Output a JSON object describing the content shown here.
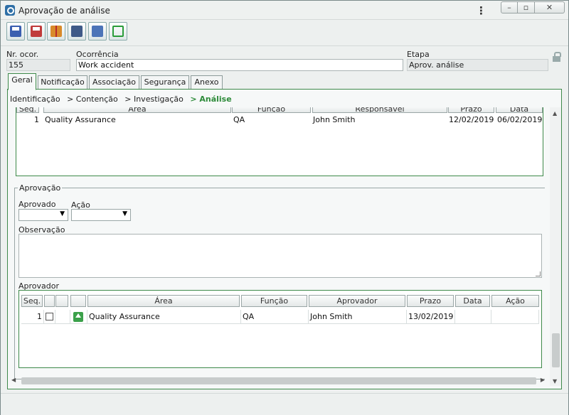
{
  "window": {
    "title": "Aprovação de análise"
  },
  "toolbar": {
    "buttons": [
      {
        "icon": "save-icon"
      },
      {
        "icon": "save-and-exit-icon"
      },
      {
        "icon": "gift-icon"
      },
      {
        "icon": "binoculars-icon"
      },
      {
        "icon": "user-icon"
      },
      {
        "icon": "refresh-icon"
      }
    ]
  },
  "header": {
    "nr_label": "Nr. ocor.",
    "nr_value": "155",
    "ocorrencia_label": "Ocorrência",
    "ocorrencia_value": "Work accident",
    "etapa_label": "Etapa",
    "etapa_value": "Aprov. análise"
  },
  "tabs": [
    {
      "label": "Geral"
    },
    {
      "label": "Notificação"
    },
    {
      "label": "Associação"
    },
    {
      "label": "Segurança"
    },
    {
      "label": "Anexo"
    }
  ],
  "breadcrumb": {
    "items": [
      "Identificação",
      "> Contenção",
      "> Investigação"
    ],
    "current": "> Análise"
  },
  "analysis_grid": {
    "columns": [
      "Seq.",
      "Área",
      "Função",
      "Responsável",
      "Prazo",
      "Data"
    ],
    "rows": [
      {
        "seq": "1",
        "area": "Quality Assurance",
        "funcao": "QA",
        "responsavel": "John Smith",
        "prazo": "12/02/2019",
        "data": "06/02/2019"
      }
    ]
  },
  "aprovacao": {
    "legend": "Aprovação",
    "aprovado_label": "Aprovado",
    "aprovado_value": "",
    "acao_label": "Ação",
    "acao_value": "",
    "observacao_label": "Observação",
    "observacao_value": "",
    "aprovador_label": "Aprovador",
    "grid": {
      "columns": [
        "Seq.",
        "",
        "",
        "",
        "Área",
        "Função",
        "Aprovador",
        "Prazo",
        "Data",
        "Ação"
      ],
      "rows": [
        {
          "seq": "1",
          "checked": false,
          "area": "Quality Assurance",
          "funcao": "QA",
          "aprovador": "John Smith",
          "prazo": "13/02/2019",
          "data": "",
          "acao": ""
        }
      ]
    }
  },
  "colors": {
    "accent_green": "#3e8a4a",
    "breadcrumb_current": "#2e8b3a"
  }
}
